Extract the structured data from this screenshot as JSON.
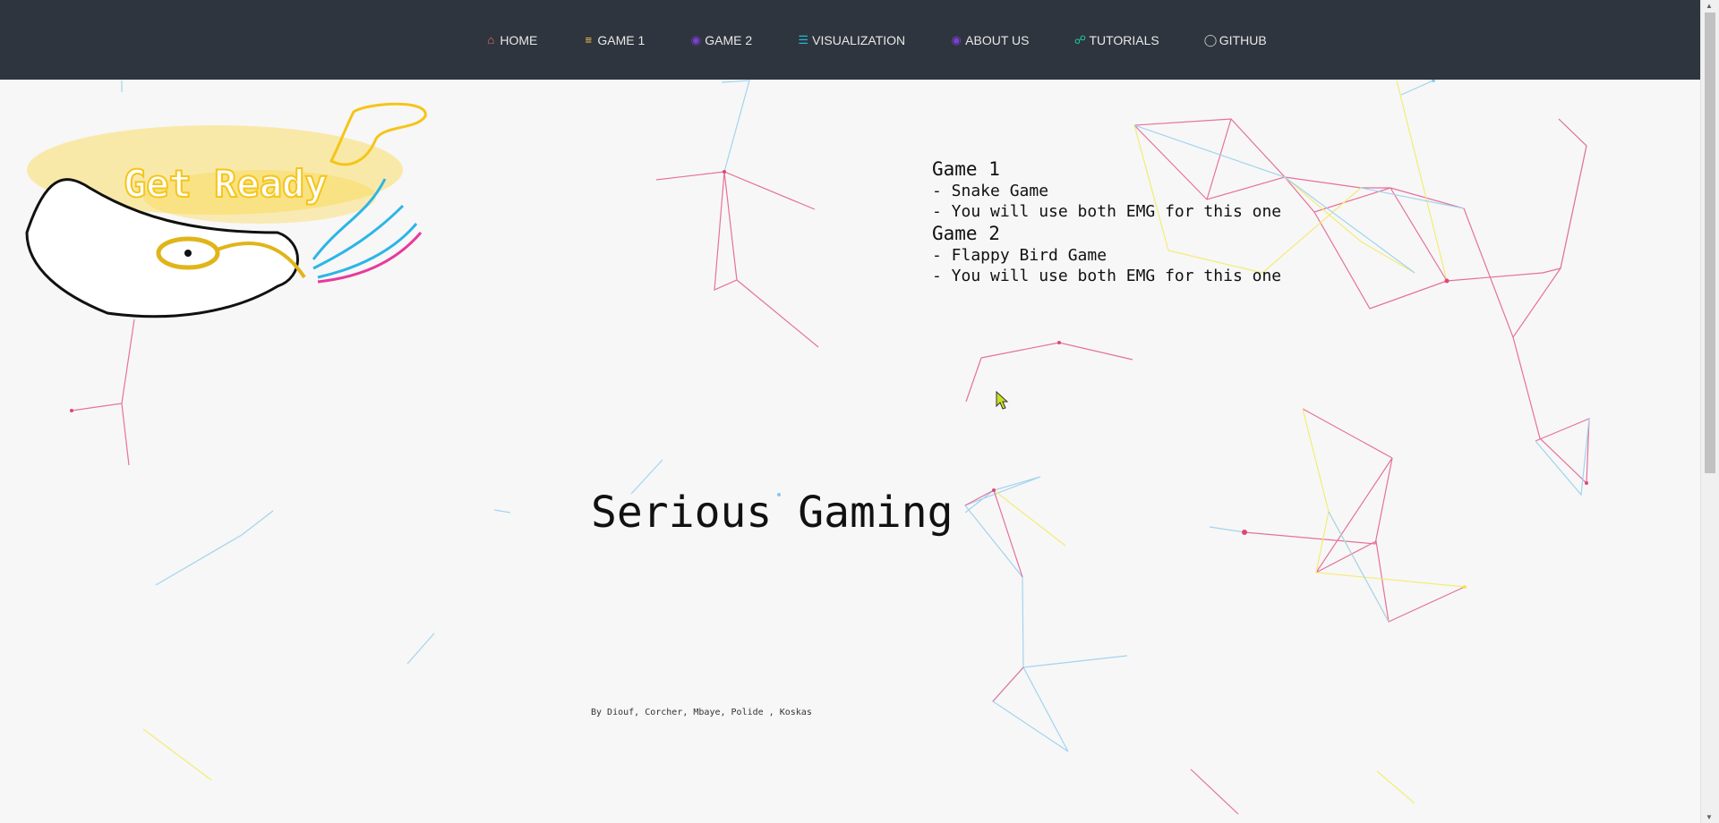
{
  "nav": {
    "items": [
      {
        "label": "HOME",
        "icon": "home-icon",
        "color": "#f26b6b"
      },
      {
        "label": "GAME 1",
        "icon": "layers-icon",
        "color": "#f5c84c"
      },
      {
        "label": "GAME 2",
        "icon": "gamepad-icon",
        "color": "#7b3fd1"
      },
      {
        "label": "VISUALIZATION",
        "icon": "bars-icon",
        "color": "#22b8d0"
      },
      {
        "label": "ABOUT US",
        "icon": "users-icon",
        "color": "#7b3fd1"
      },
      {
        "label": "TUTORIALS",
        "icon": "headset-icon",
        "color": "#20c9a0"
      },
      {
        "label": "GITHUB",
        "icon": "github-icon",
        "color": "#cccccc"
      }
    ]
  },
  "hero": {
    "logo_text": "Get Ready"
  },
  "games": {
    "game1_title": "Game 1",
    "game1_name": "- Snake Game",
    "game1_note": "- You will use both EMG for this one",
    "game2_title": "Game 2",
    "game2_name": "- Flappy Bird Game",
    "game2_note": "- You will use both EMG for this one"
  },
  "title": "Serious Gaming",
  "byline": "By Diouf, Corcher, Mbaye, Polide , Koskas"
}
